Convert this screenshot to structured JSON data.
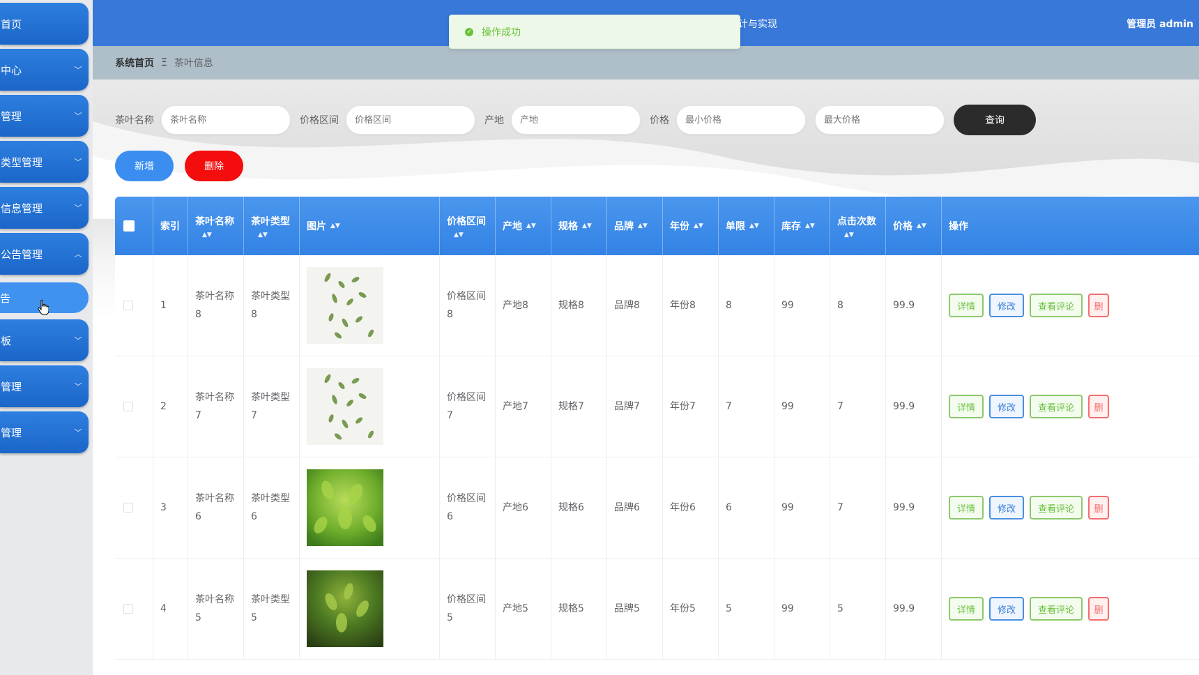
{
  "sidebar": {
    "items": [
      {
        "label": "首页",
        "chevron": ""
      },
      {
        "label": "中心",
        "chevron": "﹀"
      },
      {
        "label": "管理",
        "chevron": "﹀"
      },
      {
        "label": "类型管理",
        "chevron": "﹀"
      },
      {
        "label": "信息管理",
        "chevron": "﹀"
      },
      {
        "label": "公告管理",
        "chevron": "︿"
      },
      {
        "label": "板",
        "chevron": "﹀"
      },
      {
        "label": "管理",
        "chevron": "﹀"
      },
      {
        "label": "管理",
        "chevron": "﹀"
      }
    ],
    "submenu_active": "告"
  },
  "header": {
    "title_fragment": "计与实现",
    "user": "管理员 admin"
  },
  "toast": {
    "message": "操作成功"
  },
  "breadcrumb": {
    "home": "系统首页",
    "separator": "Ξ",
    "current": "茶叶信息"
  },
  "search": {
    "name_label": "茶叶名称",
    "name_placeholder": "茶叶名称",
    "range_label": "价格区间",
    "range_placeholder": "价格区间",
    "origin_label": "产地",
    "origin_placeholder": "产地",
    "price_label": "价格",
    "min_placeholder": "最小价格",
    "max_placeholder": "最大价格",
    "query_button": "查询"
  },
  "actions": {
    "add": "新增",
    "delete": "删除"
  },
  "table": {
    "headers": {
      "index": "索引",
      "name": "茶叶名称",
      "type": "茶叶类型",
      "image": "图片",
      "range": "价格区间",
      "origin": "产地",
      "spec": "规格",
      "brand": "品牌",
      "year": "年份",
      "limit": "单限",
      "stock": "库存",
      "clicks": "点击次数",
      "price": "价格",
      "ops": "操作"
    },
    "rows": [
      {
        "index": "1",
        "name_a": "茶叶名称",
        "name_b": "8",
        "type_a": "茶叶类型",
        "type_b": "8",
        "image": "tea-leaves-falling",
        "range_a": "价格区间",
        "range_b": "8",
        "origin": "产地8",
        "spec": "规格8",
        "brand": "品牌8",
        "year": "年份8",
        "limit": "8",
        "stock": "99",
        "clicks": "8",
        "price": "99.9"
      },
      {
        "index": "2",
        "name_a": "茶叶名称",
        "name_b": "7",
        "type_a": "茶叶类型",
        "type_b": "7",
        "image": "tea-leaves-falling",
        "range_a": "价格区间",
        "range_b": "7",
        "origin": "产地7",
        "spec": "规格7",
        "brand": "品牌7",
        "year": "年份7",
        "limit": "7",
        "stock": "99",
        "clicks": "7",
        "price": "99.9"
      },
      {
        "index": "3",
        "name_a": "茶叶名称",
        "name_b": "6",
        "type_a": "茶叶类型",
        "type_b": "6",
        "image": "tea-plant-green",
        "range_a": "价格区间",
        "range_b": "6",
        "origin": "产地6",
        "spec": "规格6",
        "brand": "品牌6",
        "year": "年份6",
        "limit": "6",
        "stock": "99",
        "clicks": "7",
        "price": "99.9"
      },
      {
        "index": "4",
        "name_a": "茶叶名称",
        "name_b": "5",
        "type_a": "茶叶类型",
        "type_b": "5",
        "image": "tea-plant-dark",
        "range_a": "价格区间",
        "range_b": "5",
        "origin": "产地5",
        "spec": "规格5",
        "brand": "品牌5",
        "year": "年份5",
        "limit": "5",
        "stock": "99",
        "clicks": "5",
        "price": "99.9"
      }
    ],
    "op_labels": {
      "detail": "详情",
      "edit": "修改",
      "comment": "查看评论",
      "remove": "删"
    }
  },
  "colors": {
    "primary": "#3778d8",
    "success": "#67c23a",
    "danger": "#f40d0d",
    "query": "#2b2b2b"
  }
}
